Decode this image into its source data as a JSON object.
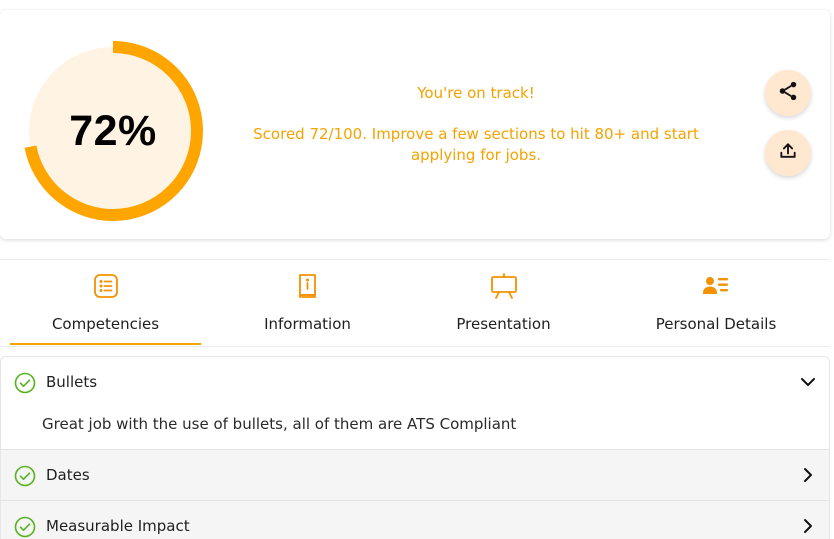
{
  "score": {
    "value_text": "72%",
    "percent": 72,
    "status": "You're on track!",
    "message": "Scored 72/100. Improve a few sections to hit 80+ and start applying for jobs.",
    "ring_color": "#ffa500",
    "ring_track_color": "#fff4e3",
    "accent_text_color": "#f4a300"
  },
  "actions": {
    "share_icon": "share-icon",
    "export_icon": "upload-icon"
  },
  "tabs": [
    {
      "label": "Competencies",
      "icon": "list-icon",
      "active": true
    },
    {
      "label": "Information",
      "icon": "book-icon",
      "active": false
    },
    {
      "label": "Presentation",
      "icon": "presentation-board-icon",
      "active": false
    },
    {
      "label": "Personal Details",
      "icon": "contact-card-icon",
      "active": false
    }
  ],
  "sections": [
    {
      "title": "Bullets",
      "expanded": true,
      "body": "Great job with the use of bullets, all of them are ATS Compliant"
    },
    {
      "title": "Dates",
      "expanded": false
    },
    {
      "title": "Measurable Impact",
      "expanded": false
    }
  ]
}
